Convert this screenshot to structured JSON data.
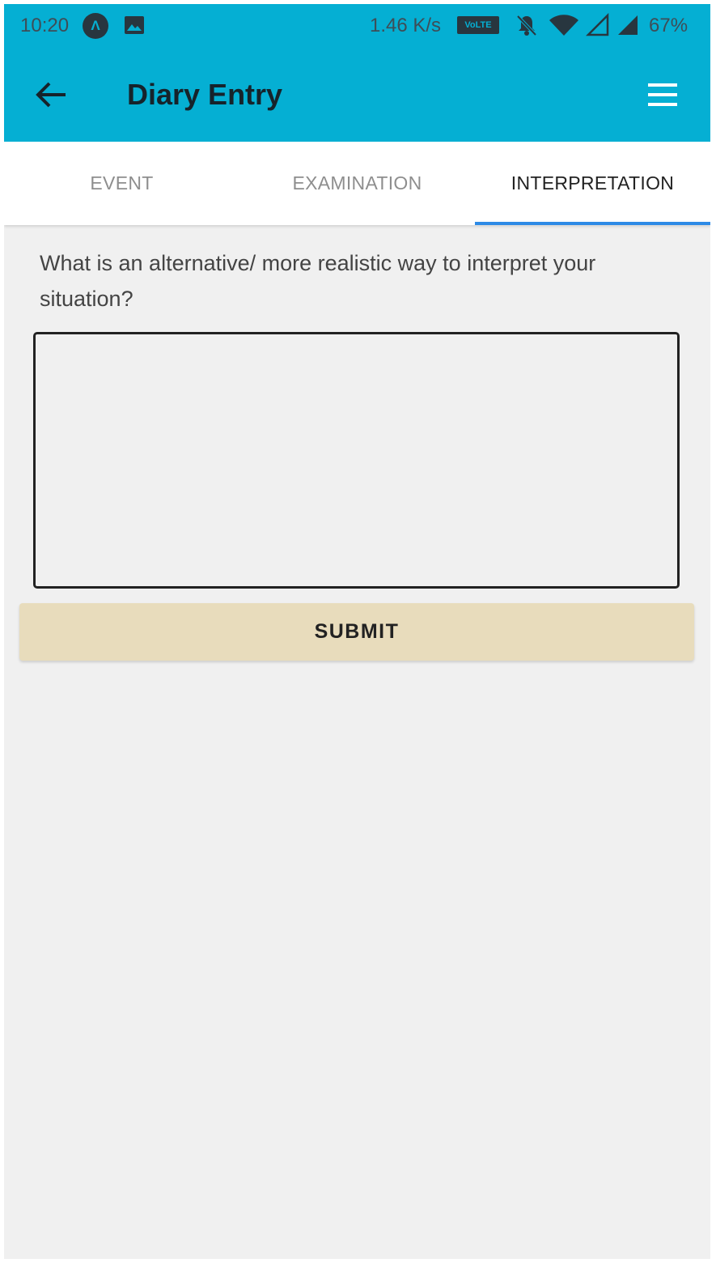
{
  "status_bar": {
    "time": "10:20",
    "app_badge": "Λ",
    "network_speed": "1.46 K/s",
    "volte_label": "VoLTE",
    "battery": "67%"
  },
  "app_bar": {
    "title": "Diary Entry",
    "back_icon": "arrow-left-icon",
    "menu_icon": "hamburger-menu-icon",
    "color": "#05afd3"
  },
  "tabs": [
    {
      "label": "EVENT",
      "active": false
    },
    {
      "label": "EXAMINATION",
      "active": false
    },
    {
      "label": "INTERPRETATION",
      "active": true
    }
  ],
  "tab_indicator_color": "#2d8ae6",
  "form": {
    "question": "What is an alternative/ more realistic way to interpret your situation?",
    "answer_value": "",
    "submit_label": "SUBMIT",
    "submit_color": "#e8dcbc"
  }
}
